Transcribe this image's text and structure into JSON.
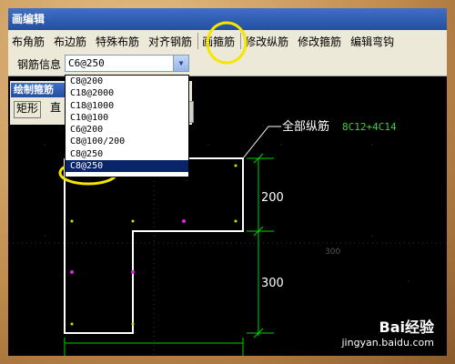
{
  "window": {
    "title": "画编辑"
  },
  "menu": {
    "items": [
      "布角筋",
      "布边筋",
      "特殊布筋",
      "对齐钢筋",
      "画箍筋",
      "修改纵筋",
      "修改箍筋",
      "编辑弯钩"
    ]
  },
  "toolbar": {
    "label": "钢筋信息",
    "combo_value": "C6@250"
  },
  "dropdown": {
    "options": [
      "C8@200",
      "C18@2000",
      "C18@1000",
      "C10@100",
      "C6@200",
      "C8@100/200",
      "C8@250",
      "C8@250"
    ],
    "selected_index": 7
  },
  "sidepanel": {
    "title": "绘制箍筋",
    "button_rect": "矩形",
    "button_line": "直"
  },
  "drawing": {
    "annotation_label": "全部纵筋",
    "annotation_value": "8C12+4C14",
    "dim_200": "200",
    "dim_300": "300",
    "dim_side": "300"
  },
  "colors": {
    "highlight": "#f5e600",
    "dim": "#00d400",
    "value_text": "#3cd13c"
  },
  "watermark": {
    "logo": "Bai经验",
    "url": "jingyan.baidu.com"
  }
}
